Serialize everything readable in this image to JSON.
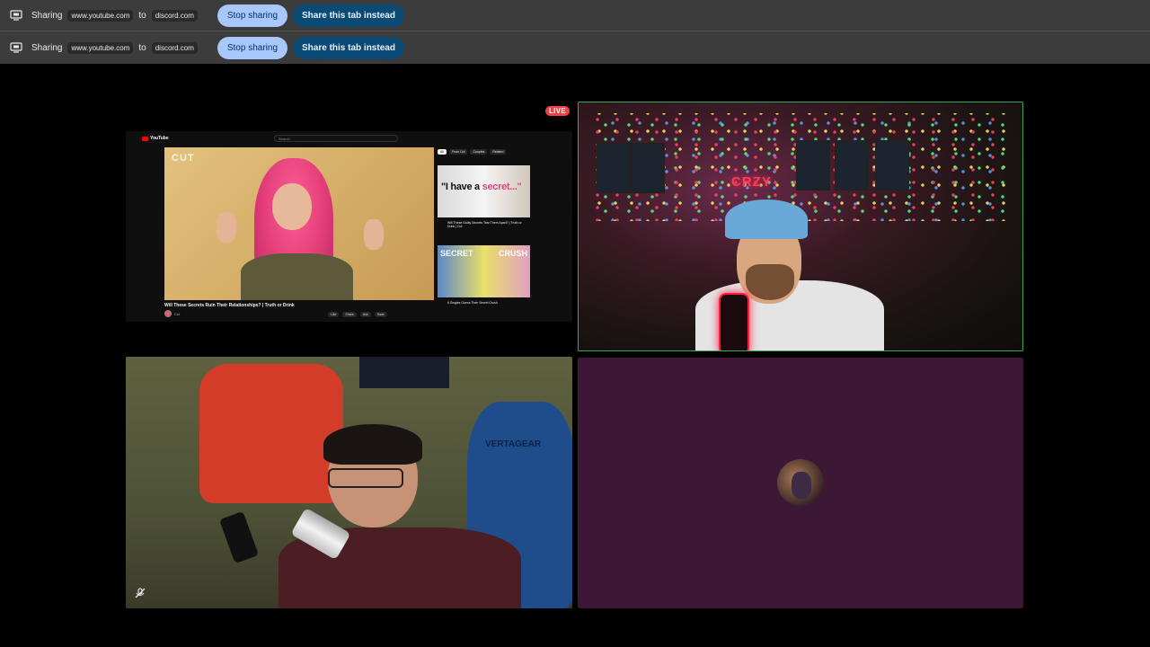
{
  "share_bars": [
    {
      "label": "Sharing",
      "source": "www.youtube.com",
      "to": "to",
      "target": "discord.com",
      "stop_label": "Stop sharing",
      "share_tab_label": "Share this tab instead"
    },
    {
      "label": "Sharing",
      "source": "www.youtube.com",
      "to": "to",
      "target": "discord.com",
      "stop_label": "Stop sharing",
      "share_tab_label": "Share this tab instead"
    }
  ],
  "call": {
    "live_badge": "LIVE",
    "screen_share": {
      "site_logo": "YouTube",
      "search_placeholder": "Search",
      "video_overlay": "CUT",
      "video_title": "Will These Secrets Ruin Their Relationships? | Truth or Drink",
      "channel_name": "Cut",
      "chips": [
        "All",
        "From Cut",
        "Couples",
        "Related"
      ],
      "actions": [
        "Like",
        "Share",
        "Ask",
        "Save"
      ],
      "sidebar_videos": [
        {
          "thumb_text_main": "\"I have a ",
          "thumb_text_accent": "secret...\"",
          "title": "Will These Guilty Secrets Tear Them Apart? | Truth or Drink | Cut"
        },
        {
          "thumb_left": "SECRET",
          "thumb_right": "CRUSH",
          "title": "6 Singles Guess Their Secret Crush"
        }
      ]
    },
    "cam1": {
      "neon_sign": "CRZY",
      "speaking_color": "#3ba55d"
    },
    "cam2": {
      "chair_brand": "VERTAGEAR",
      "muted": true
    },
    "avatar_tile": {
      "background": "#3d1736"
    }
  },
  "colors": {
    "stop_button": "#a8c7fa",
    "share_tab_button": "#0b4a75",
    "live": "#ed4245"
  }
}
